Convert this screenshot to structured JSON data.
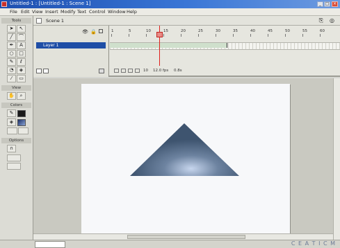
{
  "window": {
    "title": "Untitled-1 : [Untitled-1 : Scene 1]"
  },
  "menu": [
    "File",
    "Edit",
    "View",
    "Insert",
    "Modify",
    "Text",
    "Control",
    "Window",
    "Help"
  ],
  "toolbox": {
    "tools_title": "Tools",
    "view_title": "View",
    "colors_title": "Colors",
    "options_title": "Options"
  },
  "scene": {
    "label": "Scene 1"
  },
  "timeline": {
    "layer_name": "Layer 1",
    "frame_numbers": [
      "1",
      "5",
      "10",
      "15",
      "20",
      "25",
      "30",
      "35",
      "40",
      "45",
      "50",
      "55",
      "60"
    ],
    "current_frame": "10",
    "frame_rate": "12.0 fps",
    "elapsed": "0.8s"
  },
  "colors": {
    "accent": "#1f4ea6",
    "playhead": "#e0201c",
    "shape_fill": "#5d7189"
  },
  "watermark": "C E A T I C M"
}
